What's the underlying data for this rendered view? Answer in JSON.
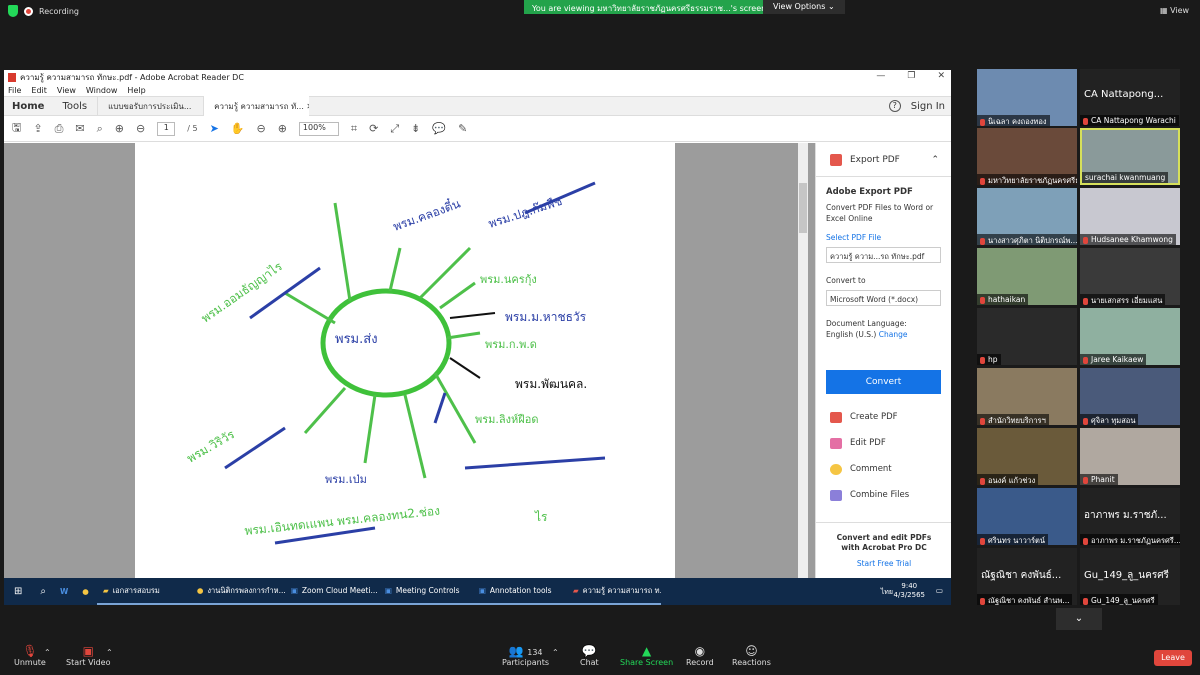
{
  "zoom": {
    "recording_label": "Recording",
    "viewing_banner": "You are viewing มหาวิทยาลัยราชภัฏนครศรีธรรมราช...'s screen",
    "view_options": "View Options ⌄",
    "view_label": "View",
    "bottom": {
      "unmute": "Unmute",
      "start_video": "Start Video",
      "participants": "Participants",
      "participants_count": "134",
      "chat": "Chat",
      "share_screen": "Share Screen",
      "record": "Record",
      "reactions": "Reactions",
      "leave": "Leave"
    }
  },
  "acrobat": {
    "window_title": "ความรู้ ความสามารถ ทักษะ.pdf - Adobe Acrobat Reader DC",
    "menu": [
      "File",
      "Edit",
      "View",
      "Window",
      "Help"
    ],
    "home": "Home",
    "tools": "Tools",
    "tabs": [
      "แบบขอรับการประเมิน...",
      "ความรู้ ความสามารถ ทั..."
    ],
    "sign_in": "Sign In",
    "page_current": "1",
    "page_total": "/ 5",
    "zoom_level": "100%",
    "panel": {
      "export_pdf": "Export PDF",
      "adobe_export_title": "Adobe Export PDF",
      "adobe_export_desc": "Convert PDF Files to Word or Excel Online",
      "select_pdf_file": "Select PDF File",
      "selected_file": "ความรู้ ความ...รถ ทักษะ.pdf",
      "convert_to_label": "Convert to",
      "convert_to_value": "Microsoft Word (*.docx)",
      "doc_language_label": "Document Language:",
      "doc_language_value": "English (U.S.)",
      "change": "Change",
      "convert_btn": "Convert",
      "create_pdf": "Create PDF",
      "edit_pdf": "Edit PDF",
      "comment": "Comment",
      "combine_files": "Combine Files",
      "footer_line1": "Convert and edit PDFs",
      "footer_line2": "with Acrobat Pro DC",
      "start_trial": "Start Free Trial"
    },
    "document_texts": [
      "พรม.ส่ง",
      "พรม.คลองตี๋น",
      "พรม.ปฎ.ก๊มพืช",
      "พรม.ออมธัญญาไร",
      "พรม.นครกุ้ง",
      "พรม.ม.หาชธวัร",
      "พรม.ก.พ.ด",
      "พรม.พัฒนคล.",
      "พรม.ลิงห์ฝือด",
      "พรม.วิริวัร",
      "พรม.เป่ม",
      "พรม.เอินทดเแพน พรม.คลองทน2.ช่อง",
      "ไร"
    ]
  },
  "taskbar": {
    "items": [
      "เอกสารสอบรม",
      "งานนิติกรพลงการกำห...",
      "Zoom Cloud Meeti...",
      "Meeting Controls",
      "Annotation tools",
      "ความรู้ ความสามารถ ท..."
    ],
    "time": "9:40",
    "date": "4/3/2565",
    "lang": "ไทย"
  },
  "gallery": [
    {
      "name": "นิเฉลา คงถองทอง",
      "big": ""
    },
    {
      "name": "CA Nattapong Warachi",
      "big": "CA  Nattapong..."
    },
    {
      "name": "มหาวิทยาลัยราชภัฏนครศรีธ...",
      "big": ""
    },
    {
      "name": "surachai kwanmuang",
      "big": ""
    },
    {
      "name": "นางสาวศุภิตา นิติปกรณ์พ...",
      "big": ""
    },
    {
      "name": "Hudsanee Khamwong",
      "big": ""
    },
    {
      "name": "hathaikan",
      "big": ""
    },
    {
      "name": "นายเสกสรร เอี่ยมแสน",
      "big": ""
    },
    {
      "name": "hp",
      "big": ""
    },
    {
      "name": "Jaree Kaikaew",
      "big": ""
    },
    {
      "name": "สำนักวิทยบริการฯ",
      "big": ""
    },
    {
      "name": "ศุจิลา ทุมสอน",
      "big": ""
    },
    {
      "name": "อนงค์ แก้วช่วง",
      "big": ""
    },
    {
      "name": "Phanit",
      "big": ""
    },
    {
      "name": "ศรินทร นาวาร์ตน์",
      "big": ""
    },
    {
      "name": "อาภาพร ม.ราชภัฏนครศรี...",
      "big": "อาภาพร ม.ราชภั..."
    },
    {
      "name": "ณัฐณิชา คงพันธ์ สำนพ...",
      "big": "ณัฐณิชา คงพันธ์..."
    },
    {
      "name": "Gu_149_ลู_นครศรี",
      "big": "Gu_149_ลู_นครศรี"
    }
  ],
  "colors": {
    "zoom_green": "#23a34b",
    "adobe_blue": "#1473e6",
    "leave_red": "#e0463c"
  }
}
